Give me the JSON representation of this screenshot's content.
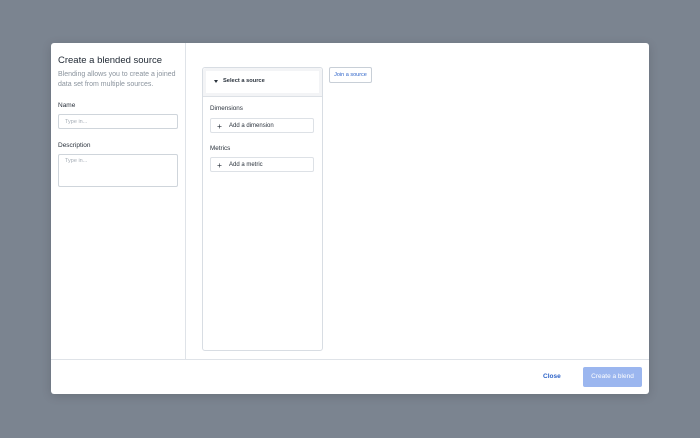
{
  "dialog": {
    "title": "Create a blended source",
    "description": "Blending allows you to create a joined data set from multiple sources."
  },
  "form": {
    "name": {
      "label": "Name",
      "placeholder": "Type in...",
      "value": ""
    },
    "description": {
      "label": "Description",
      "placeholder": "Type in...",
      "value": ""
    }
  },
  "source_card": {
    "select_label": "Select a source",
    "dimensions_label": "Dimensions",
    "add_dimension_label": "Add a dimension",
    "metrics_label": "Metrics",
    "add_metric_label": "Add a metric",
    "icons": {
      "caret": "caret-down-icon",
      "plus": "plus-icon"
    }
  },
  "join_button_label": "Join a source",
  "footer": {
    "close_label": "Close",
    "create_label": "Create a blend"
  },
  "colors": {
    "overlay": "#7b8490",
    "link": "#2d63c8",
    "primary_disabled": "#9bb6ef"
  }
}
